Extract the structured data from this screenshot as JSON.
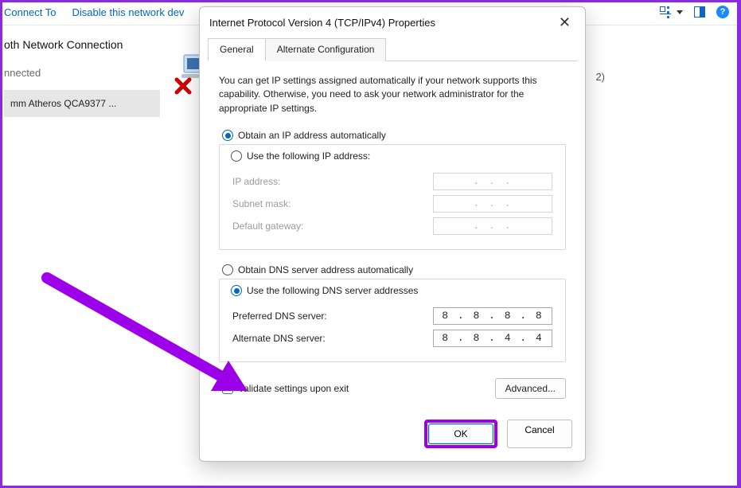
{
  "toolbar": {
    "connect_to": "Connect To",
    "disable": "Disable this network dev"
  },
  "background": {
    "connection_title": "oth Network Connection",
    "status": "nnected",
    "device_name": "mm Atheros QCA9377 ...",
    "count_suffix": "2)"
  },
  "dialog": {
    "title": "Internet Protocol Version 4 (TCP/IPv4) Properties",
    "tabs": {
      "general": "General",
      "alt": "Alternate Configuration"
    },
    "intro": "You can get IP settings assigned automatically if your network supports this capability. Otherwise, you need to ask your network administrator for the appropriate IP settings.",
    "ip": {
      "auto_label": "Obtain an IP address automatically",
      "manual_label": "Use the following IP address:",
      "addr_label": "IP address:",
      "subnet_label": "Subnet mask:",
      "gateway_label": "Default gateway:",
      "dot_placeholder": ".      .      ."
    },
    "dns": {
      "auto_label": "Obtain DNS server address automatically",
      "manual_label": "Use the following DNS server addresses",
      "preferred_label": "Preferred DNS server:",
      "alternate_label": "Alternate DNS server:",
      "preferred_value": "8 . 8 . 8 . 8",
      "alternate_value": "8 . 8 . 4 . 4"
    },
    "validate_label": "Validate settings upon exit",
    "advanced_btn": "Advanced...",
    "ok_btn": "OK",
    "cancel_btn": "Cancel"
  }
}
